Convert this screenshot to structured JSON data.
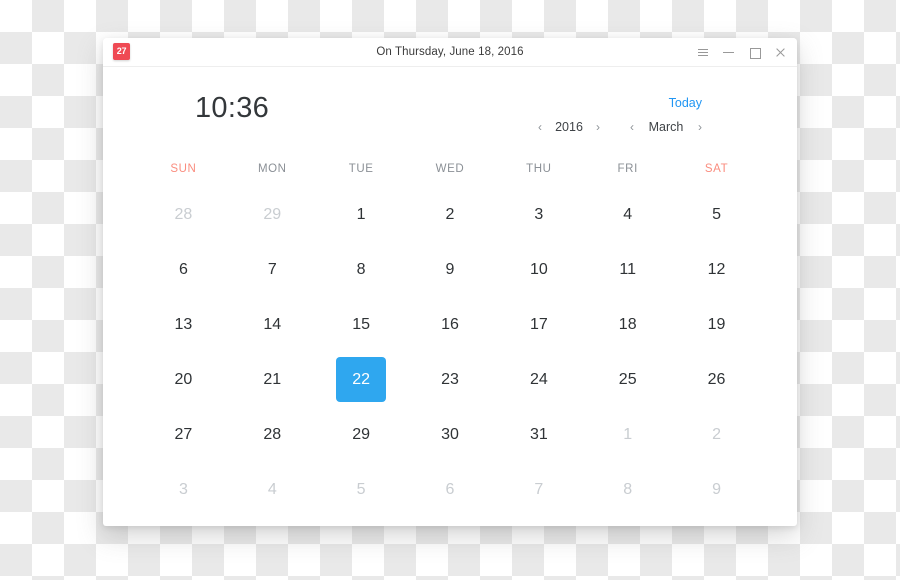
{
  "window": {
    "title": "On Thursday, June 18, 2016",
    "app_icon_label": "27",
    "controls": {
      "menu": "menu",
      "minimize": "minimize",
      "maximize": "maximize",
      "close": "close"
    }
  },
  "header": {
    "clock": "10:36",
    "today_label": "Today",
    "year": {
      "prev": "‹",
      "value": "2016",
      "next": "›"
    },
    "month": {
      "prev": "‹",
      "value": "March",
      "next": "›"
    }
  },
  "calendar": {
    "weekdays": [
      {
        "label": "SUN",
        "weekend": true
      },
      {
        "label": "MON",
        "weekend": false
      },
      {
        "label": "TUE",
        "weekend": false
      },
      {
        "label": "WED",
        "weekend": false
      },
      {
        "label": "THU",
        "weekend": false
      },
      {
        "label": "FRI",
        "weekend": false
      },
      {
        "label": "SAT",
        "weekend": true
      }
    ],
    "selected_day": "22",
    "weeks": [
      [
        {
          "day": "28",
          "state": "muted"
        },
        {
          "day": "29",
          "state": "muted"
        },
        {
          "day": "1",
          "state": "normal"
        },
        {
          "day": "2",
          "state": "normal"
        },
        {
          "day": "3",
          "state": "normal"
        },
        {
          "day": "4",
          "state": "normal"
        },
        {
          "day": "5",
          "state": "normal"
        }
      ],
      [
        {
          "day": "6",
          "state": "normal"
        },
        {
          "day": "7",
          "state": "normal"
        },
        {
          "day": "8",
          "state": "normal"
        },
        {
          "day": "9",
          "state": "normal"
        },
        {
          "day": "10",
          "state": "normal"
        },
        {
          "day": "11",
          "state": "normal"
        },
        {
          "day": "12",
          "state": "normal"
        }
      ],
      [
        {
          "day": "13",
          "state": "normal"
        },
        {
          "day": "14",
          "state": "normal"
        },
        {
          "day": "15",
          "state": "normal"
        },
        {
          "day": "16",
          "state": "normal"
        },
        {
          "day": "17",
          "state": "normal"
        },
        {
          "day": "18",
          "state": "normal"
        },
        {
          "day": "19",
          "state": "normal"
        }
      ],
      [
        {
          "day": "20",
          "state": "normal"
        },
        {
          "day": "21",
          "state": "normal"
        },
        {
          "day": "22",
          "state": "selected"
        },
        {
          "day": "23",
          "state": "normal"
        },
        {
          "day": "24",
          "state": "normal"
        },
        {
          "day": "25",
          "state": "normal"
        },
        {
          "day": "26",
          "state": "normal"
        }
      ],
      [
        {
          "day": "27",
          "state": "normal"
        },
        {
          "day": "28",
          "state": "normal"
        },
        {
          "day": "29",
          "state": "normal"
        },
        {
          "day": "30",
          "state": "normal"
        },
        {
          "day": "31",
          "state": "normal"
        },
        {
          "day": "1",
          "state": "muted"
        },
        {
          "day": "2",
          "state": "muted"
        }
      ],
      [
        {
          "day": "3",
          "state": "muted"
        },
        {
          "day": "4",
          "state": "muted"
        },
        {
          "day": "5",
          "state": "muted"
        },
        {
          "day": "6",
          "state": "muted"
        },
        {
          "day": "7",
          "state": "muted"
        },
        {
          "day": "8",
          "state": "muted"
        },
        {
          "day": "9",
          "state": "muted"
        }
      ]
    ]
  },
  "colors": {
    "accent_blue": "#2fa7ef",
    "link_blue": "#2196f3",
    "weekend_red": "#fa8d7f",
    "icon_red": "#ef4a54",
    "muted_gray": "#c9cdd1",
    "text_dark": "#2f3336"
  }
}
